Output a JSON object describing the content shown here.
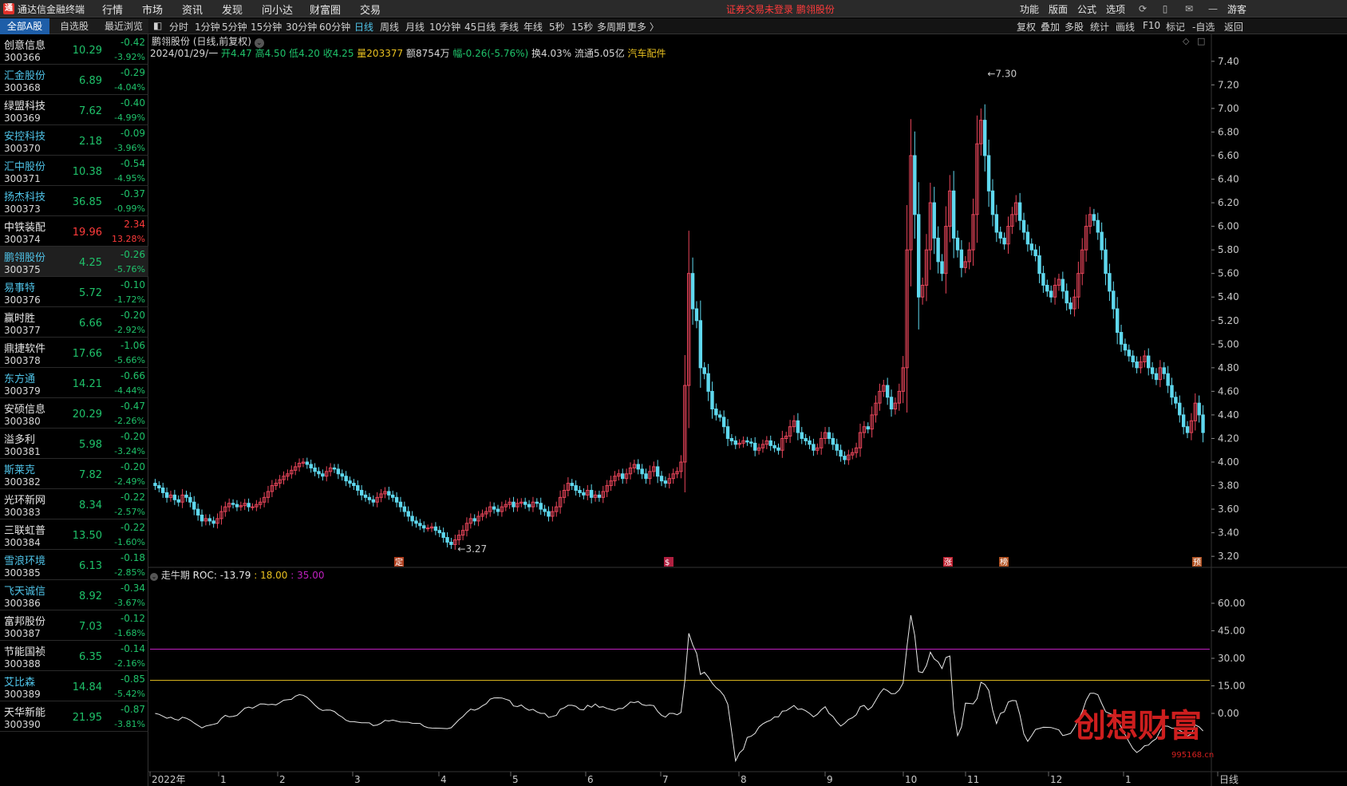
{
  "app": {
    "title": "通达信金融终端",
    "menu": [
      "行情",
      "市场",
      "资讯",
      "发现",
      "问小达",
      "财富圈",
      "交易"
    ],
    "status_text": "证券交易未登录  鹏翎股份",
    "right_menu": [
      "功能",
      "版面",
      "公式",
      "选项"
    ],
    "guest_label": "游客"
  },
  "left_panel": {
    "tabs": [
      "全部A股",
      "自选股",
      "最近浏览"
    ],
    "stocks": [
      {
        "name": "创意信息",
        "code": "300366",
        "price": "10.29",
        "change": "-0.42",
        "pct": "-3.92%",
        "dir": "dn",
        "link": false
      },
      {
        "name": "汇金股份",
        "code": "300368",
        "price": "6.89",
        "change": "-0.29",
        "pct": "-4.04%",
        "dir": "dn",
        "link": true
      },
      {
        "name": "绿盟科技",
        "code": "300369",
        "price": "7.62",
        "change": "-0.40",
        "pct": "-4.99%",
        "dir": "dn",
        "link": false
      },
      {
        "name": "安控科技",
        "code": "300370",
        "price": "2.18",
        "change": "-0.09",
        "pct": "-3.96%",
        "dir": "dn",
        "link": true
      },
      {
        "name": "汇中股份",
        "code": "300371",
        "price": "10.38",
        "change": "-0.54",
        "pct": "-4.95%",
        "dir": "dn",
        "link": true
      },
      {
        "name": "扬杰科技",
        "code": "300373",
        "price": "36.85",
        "change": "-0.37",
        "pct": "-0.99%",
        "dir": "dn",
        "link": true
      },
      {
        "name": "中铁装配",
        "code": "300374",
        "price": "19.96",
        "change": "2.34",
        "pct": "13.28%",
        "dir": "up",
        "link": false
      },
      {
        "name": "鹏翎股份",
        "code": "300375",
        "price": "4.25",
        "change": "-0.26",
        "pct": "-5.76%",
        "dir": "dn",
        "link": true,
        "selected": true
      },
      {
        "name": "易事特",
        "code": "300376",
        "price": "5.72",
        "change": "-0.10",
        "pct": "-1.72%",
        "dir": "dn",
        "link": true
      },
      {
        "name": "赢时胜",
        "code": "300377",
        "price": "6.66",
        "change": "-0.20",
        "pct": "-2.92%",
        "dir": "dn",
        "link": false
      },
      {
        "name": "鼎捷软件",
        "code": "300378",
        "price": "17.66",
        "change": "-1.06",
        "pct": "-5.66%",
        "dir": "dn",
        "link": false
      },
      {
        "name": "东方通",
        "code": "300379",
        "price": "14.21",
        "change": "-0.66",
        "pct": "-4.44%",
        "dir": "dn",
        "link": true
      },
      {
        "name": "安硕信息",
        "code": "300380",
        "price": "20.29",
        "change": "-0.47",
        "pct": "-2.26%",
        "dir": "dn",
        "link": false
      },
      {
        "name": "溢多利",
        "code": "300381",
        "price": "5.98",
        "change": "-0.20",
        "pct": "-3.24%",
        "dir": "dn",
        "link": false
      },
      {
        "name": "斯莱克",
        "code": "300382",
        "price": "7.82",
        "change": "-0.20",
        "pct": "-2.49%",
        "dir": "dn",
        "link": true
      },
      {
        "name": "光环新网",
        "code": "300383",
        "price": "8.34",
        "change": "-0.22",
        "pct": "-2.57%",
        "dir": "dn",
        "link": false
      },
      {
        "name": "三联虹普",
        "code": "300384",
        "price": "13.50",
        "change": "-0.22",
        "pct": "-1.60%",
        "dir": "dn",
        "link": false
      },
      {
        "name": "雪浪环境",
        "code": "300385",
        "price": "6.13",
        "change": "-0.18",
        "pct": "-2.85%",
        "dir": "dn",
        "link": true
      },
      {
        "name": "飞天诚信",
        "code": "300386",
        "price": "8.92",
        "change": "-0.34",
        "pct": "-3.67%",
        "dir": "dn",
        "link": true
      },
      {
        "name": "富邦股份",
        "code": "300387",
        "price": "7.03",
        "change": "-0.12",
        "pct": "-1.68%",
        "dir": "dn",
        "link": false
      },
      {
        "name": "节能国祯",
        "code": "300388",
        "price": "6.35",
        "change": "-0.14",
        "pct": "-2.16%",
        "dir": "dn",
        "link": false
      },
      {
        "name": "艾比森",
        "code": "300389",
        "price": "14.84",
        "change": "-0.85",
        "pct": "-5.42%",
        "dir": "dn",
        "link": true
      },
      {
        "name": "天华新能",
        "code": "300390",
        "price": "21.95",
        "change": "-0.87",
        "pct": "-3.81%",
        "dir": "dn",
        "link": false
      }
    ]
  },
  "toolbar": {
    "periods": [
      "分时",
      "1分钟",
      "5分钟",
      "15分钟",
      "30分钟",
      "60分钟",
      "日线",
      "周线",
      "月线",
      "10分钟",
      "45日线",
      "季线",
      "年线",
      "5秒",
      "15秒",
      "多周期",
      "更多 〉"
    ],
    "active_period": "日线",
    "right": [
      "复权",
      "叠加",
      "多股",
      "统计",
      "画线",
      "F10",
      "标记",
      "-自选",
      "返回"
    ]
  },
  "chart_header": {
    "title": "鹏翎股份 (日线,前复权)",
    "date": "2024/01/29/一",
    "open": "开4.47",
    "high": "高4.50",
    "low": "低4.20",
    "close": "收4.25",
    "volume": "量203377",
    "amount": "额8754万",
    "amplitude": "幅-0.26(-5.76%)",
    "turnover": "换4.03%",
    "float_cap": "流通5.05亿",
    "sector": "汽车配件"
  },
  "indicator_header": {
    "name": "走牛期",
    "roc": "ROC: -13.79",
    "p1": "18.00",
    "p2": "35.00",
    "colors": {
      "roc": "#e8e8e8",
      "p1": "#e8c020",
      "p2": "#c020c0"
    }
  },
  "colors": {
    "up": "#ff3b3b",
    "down": "#1fc26a",
    "candle_up": "#e8455a",
    "candle_down": "#5fd8ee",
    "accent": "#1e5ea8",
    "link": "#4fc3e8"
  },
  "watermark": {
    "text": "创想财富",
    "url": "995168.cn"
  },
  "markers": [
    "定",
    "$",
    "涨",
    "榜",
    "预"
  ],
  "chart_data": [
    {
      "type": "candlestick",
      "title": "鹏翎股份 (日线,前复权)",
      "y_ticks": [
        7.4,
        7.2,
        7.0,
        6.8,
        6.6,
        6.4,
        6.2,
        6.0,
        5.8,
        5.6,
        5.4,
        5.2,
        5.0,
        4.8,
        4.6,
        4.4,
        4.2,
        4.0,
        3.8,
        3.6,
        3.4,
        3.2
      ],
      "ylim": [
        3.12,
        7.48
      ],
      "annotations": [
        {
          "label": "7.30",
          "value": 7.3
        },
        {
          "label": "3.27",
          "value": 3.27
        }
      ],
      "x_labels": [
        "2022年",
        "1",
        "2",
        "3",
        "4",
        "5",
        "6",
        "7",
        "8",
        "9",
        "10",
        "11",
        "12",
        "1",
        "日线"
      ],
      "close_series": [
        3.8,
        3.78,
        3.74,
        3.7,
        3.72,
        3.68,
        3.66,
        3.72,
        3.7,
        3.66,
        3.6,
        3.55,
        3.5,
        3.52,
        3.5,
        3.48,
        3.52,
        3.58,
        3.62,
        3.65,
        3.64,
        3.62,
        3.63,
        3.65,
        3.62,
        3.62,
        3.64,
        3.66,
        3.7,
        3.75,
        3.8,
        3.82,
        3.85,
        3.88,
        3.9,
        3.93,
        3.96,
        3.99,
        4.0,
        3.98,
        3.95,
        3.92,
        3.9,
        3.88,
        3.92,
        3.95,
        3.94,
        3.9,
        3.88,
        3.84,
        3.82,
        3.8,
        3.76,
        3.72,
        3.7,
        3.68,
        3.66,
        3.7,
        3.73,
        3.75,
        3.72,
        3.7,
        3.66,
        3.62,
        3.58,
        3.54,
        3.5,
        3.48,
        3.46,
        3.44,
        3.44,
        3.45,
        3.42,
        3.4,
        3.36,
        3.32,
        3.3,
        3.34,
        3.38,
        3.42,
        3.48,
        3.52,
        3.5,
        3.54,
        3.56,
        3.58,
        3.62,
        3.6,
        3.58,
        3.62,
        3.64,
        3.66,
        3.62,
        3.65,
        3.66,
        3.64,
        3.62,
        3.66,
        3.65,
        3.6,
        3.58,
        3.54,
        3.58,
        3.62,
        3.7,
        3.76,
        3.82,
        3.8,
        3.76,
        3.74,
        3.72,
        3.76,
        3.7,
        3.72,
        3.7,
        3.75,
        3.8,
        3.84,
        3.88,
        3.9,
        3.86,
        3.9,
        3.95,
        3.98,
        3.94,
        3.9,
        3.86,
        3.92,
        3.96,
        3.88,
        3.84,
        3.82,
        3.86,
        3.9,
        3.92,
        4.0,
        4.65,
        5.6,
        5.3,
        5.2,
        4.8,
        4.75,
        4.6,
        4.45,
        4.4,
        4.38,
        4.3,
        4.2,
        4.18,
        4.15,
        4.16,
        4.18,
        4.17,
        4.16,
        4.1,
        4.12,
        4.15,
        4.18,
        4.14,
        4.12,
        4.1,
        4.2,
        4.22,
        4.3,
        4.35,
        4.25,
        4.2,
        4.18,
        4.15,
        4.1,
        4.12,
        4.2,
        4.25,
        4.2,
        4.15,
        4.1,
        4.05,
        4.02,
        4.06,
        4.08,
        4.12,
        4.25,
        4.3,
        4.28,
        4.4,
        4.5,
        4.6,
        4.65,
        4.55,
        4.45,
        4.5,
        4.6,
        4.8,
        5.8,
        6.6,
        6.1,
        5.4,
        5.5,
        5.8,
        6.2,
        5.9,
        5.7,
        5.6,
        6.0,
        6.3,
        5.9,
        5.8,
        5.65,
        5.7,
        5.8,
        6.1,
        6.7,
        6.9,
        6.6,
        6.3,
        6.1,
        5.95,
        5.9,
        5.85,
        6.0,
        6.1,
        6.2,
        6.05,
        5.95,
        5.85,
        5.8,
        5.75,
        5.6,
        5.5,
        5.45,
        5.4,
        5.5,
        5.55,
        5.45,
        5.35,
        5.3,
        5.4,
        5.6,
        5.8,
        6.0,
        6.1,
        6.05,
        5.95,
        5.8,
        5.6,
        5.45,
        5.3,
        5.1,
        5.0,
        4.95,
        4.9,
        4.85,
        4.8,
        4.85,
        4.9,
        4.8,
        4.75,
        4.7,
        4.8,
        4.75,
        4.65,
        4.55,
        4.5,
        4.4,
        4.3,
        4.25,
        4.35,
        4.5,
        4.4,
        4.25
      ]
    },
    {
      "type": "line",
      "title": "走牛期",
      "series": [
        {
          "name": "ROC",
          "last": -13.79
        }
      ],
      "ref_lines": [
        18.0,
        35.0
      ],
      "y_ticks": [
        60.0,
        45.0,
        30.0,
        15.0,
        0.0
      ],
      "ylim": [
        -30,
        70
      ]
    }
  ]
}
